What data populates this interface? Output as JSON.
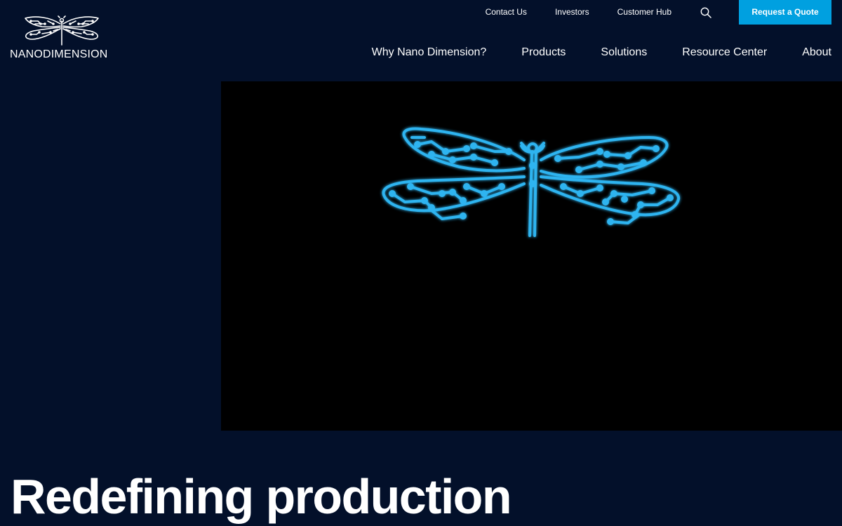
{
  "brand": {
    "name_light": "NANO",
    "name_bold": "DIMENSION",
    "logo_icon": "dragonfly-circuit-icon"
  },
  "utility_nav": {
    "contact": "Contact Us",
    "investors": "Investors",
    "customer_hub": "Customer Hub",
    "search_icon": "search-icon",
    "quote_button": "Request a Quote"
  },
  "main_nav": {
    "items": [
      {
        "label": "Why Nano Dimension?"
      },
      {
        "label": "Products"
      },
      {
        "label": "Solutions"
      },
      {
        "label": "Resource Center"
      },
      {
        "label": "About"
      }
    ]
  },
  "hero": {
    "media_icon": "dragonfly-circuit-icon",
    "headline": "Redefining production"
  },
  "colors": {
    "background": "#03102a",
    "accent": "#00a0e0",
    "dragonfly_glow": "#2fb4f0",
    "video_bg": "#000000"
  }
}
